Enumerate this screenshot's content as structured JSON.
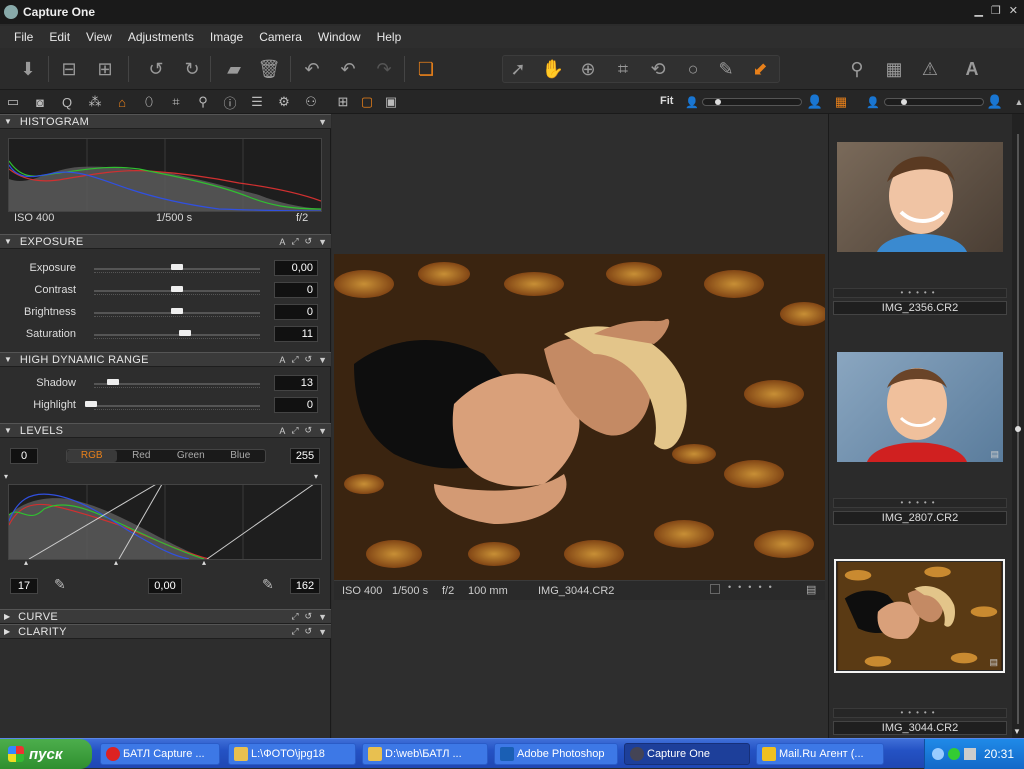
{
  "window": {
    "title": "Capture One"
  },
  "menu": [
    "File",
    "Edit",
    "View",
    "Adjustments",
    "Image",
    "Camera",
    "Window",
    "Help"
  ],
  "viewer_top": {
    "fit_label": "Fit"
  },
  "histogram": {
    "title": "HISTOGRAM",
    "iso": "ISO 400",
    "shutter": "1/500 s",
    "aperture": "f/2"
  },
  "exposure": {
    "title": "EXPOSURE",
    "sliders": [
      {
        "label": "Exposure",
        "value": "0,00",
        "pos": 0.5
      },
      {
        "label": "Contrast",
        "value": "0",
        "pos": 0.5
      },
      {
        "label": "Brightness",
        "value": "0",
        "pos": 0.5
      },
      {
        "label": "Saturation",
        "value": "11",
        "pos": 0.55
      }
    ]
  },
  "hdr": {
    "title": "HIGH DYNAMIC RANGE",
    "sliders": [
      {
        "label": "Shadow",
        "value": "13",
        "pos": 0.13
      },
      {
        "label": "Highlight",
        "value": "0",
        "pos": 0.0
      }
    ]
  },
  "levels": {
    "title": "LEVELS",
    "in_low": "0",
    "in_high": "255",
    "channels": [
      "RGB",
      "Red",
      "Green",
      "Blue"
    ],
    "active_channel": "RGB",
    "out_low": "17",
    "mid": "0,00",
    "out_high": "162"
  },
  "collapsed_panels": [
    "CURVE",
    "CLARITY"
  ],
  "viewer": {
    "iso": "ISO 400",
    "shutter": "1/500 s",
    "aperture": "f/2",
    "focal": "100 mm",
    "filename": "IMG_3044.CR2"
  },
  "thumbnails": [
    {
      "filename": "IMG_2356.CR2",
      "selected": false
    },
    {
      "filename": "IMG_2807.CR2",
      "selected": false
    },
    {
      "filename": "IMG_3044.CR2",
      "selected": true
    }
  ],
  "taskbar": {
    "start_label": "пуск",
    "tasks": [
      {
        "label": "БАТЛ Capture ...",
        "icon_color": "#d22",
        "active": false
      },
      {
        "label": "L:\\ФОТО\\jpg18",
        "icon_color": "#e8c050",
        "active": false
      },
      {
        "label": "D:\\web\\БАТЛ ...",
        "icon_color": "#e8c050",
        "active": false
      },
      {
        "label": "Adobe Photoshop",
        "icon_color": "#1a5fb4",
        "active": false
      },
      {
        "label": "Capture One",
        "icon_color": "#445",
        "active": true
      },
      {
        "label": "Mail.Ru Агент (...",
        "icon_color": "#f0c020",
        "active": false
      }
    ],
    "clock": "20:31"
  },
  "colors": {
    "accent": "#e8801a",
    "panel_bg": "#2d2d2d",
    "header_bg": "#3a3a3a"
  }
}
